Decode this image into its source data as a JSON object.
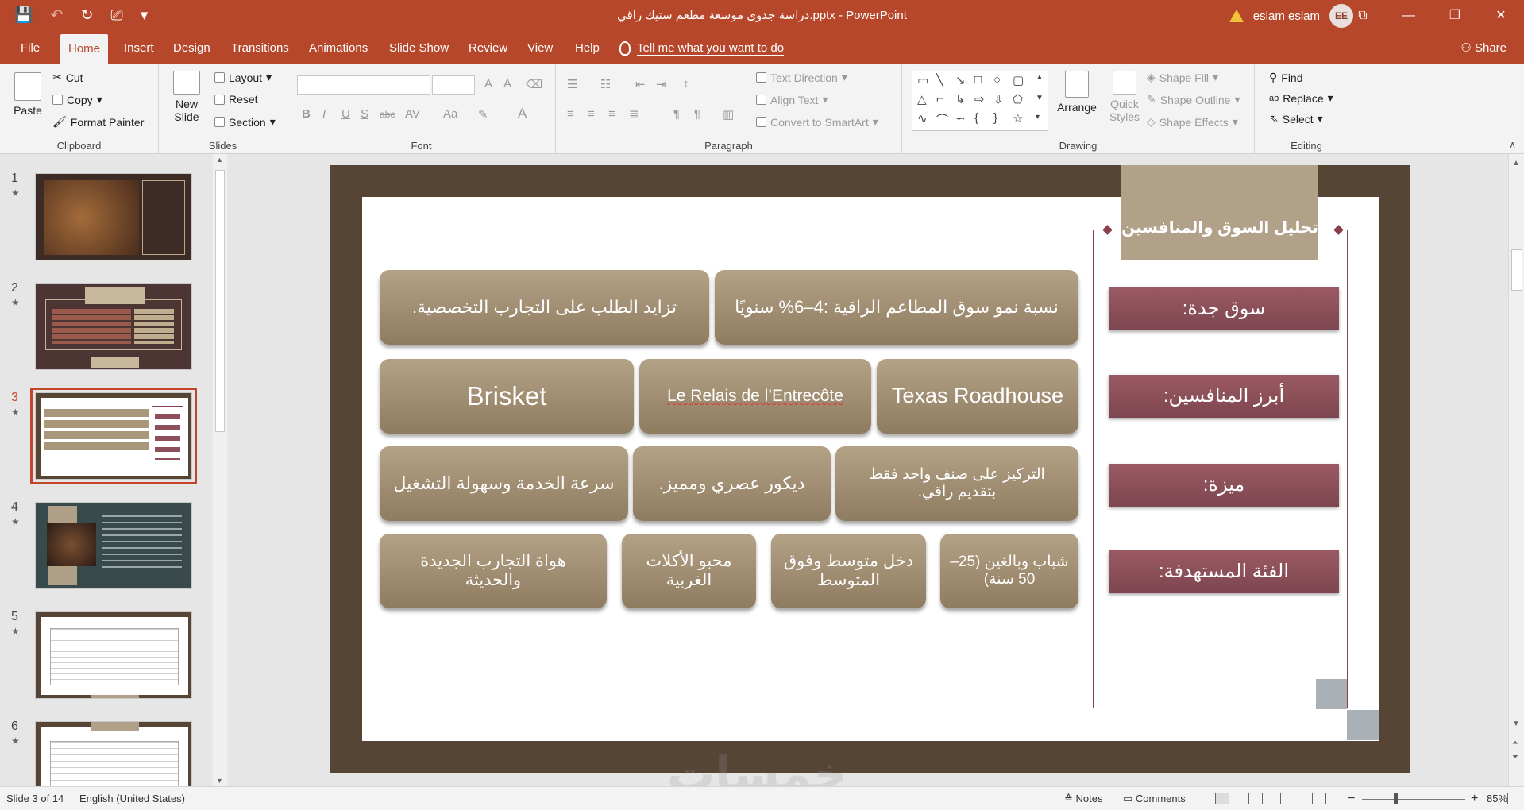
{
  "titlebar": {
    "doc_title": "دراسة جدوى موسعة مطعم ستيك راقي.pptx  -  PowerPoint",
    "user_name": "eslam eslam",
    "user_initials": "EE",
    "qat": {
      "save": "💾",
      "undo": "↶",
      "redo": "↻",
      "present": "⎚",
      "more": "▾"
    },
    "controls": {
      "ribbon_display": "⧉",
      "minimize": "—",
      "restore": "❐",
      "close": "✕"
    }
  },
  "tabs": [
    {
      "label": "File"
    },
    {
      "label": "Home"
    },
    {
      "label": "Insert"
    },
    {
      "label": "Design"
    },
    {
      "label": "Transitions"
    },
    {
      "label": "Animations"
    },
    {
      "label": "Slide Show"
    },
    {
      "label": "Review"
    },
    {
      "label": "View"
    },
    {
      "label": "Help"
    }
  ],
  "tell_me": "Tell me what you want to do",
  "share_label": "Share",
  "ribbon": {
    "clipboard": {
      "label": "Clipboard",
      "paste": "Paste",
      "cut": "Cut",
      "copy": "Copy",
      "format_painter": "Format Painter"
    },
    "slides": {
      "label": "Slides",
      "new_slide_1": "New",
      "new_slide_2": "Slide",
      "layout": "Layout",
      "reset": "Reset",
      "section": "Section"
    },
    "font": {
      "label": "Font"
    },
    "paragraph": {
      "label": "Paragraph",
      "text_direction": "Text Direction",
      "align_text": "Align Text",
      "convert_smartart": "Convert to SmartArt"
    },
    "drawing": {
      "label": "Drawing",
      "arrange": "Arrange",
      "quick_styles_1": "Quick",
      "quick_styles_2": "Styles",
      "shape_fill": "Shape Fill",
      "shape_outline": "Shape Outline",
      "shape_effects": "Shape Effects"
    },
    "editing": {
      "label": "Editing",
      "find": "Find",
      "replace": "Replace",
      "select": "Select"
    }
  },
  "thumbnails": [
    {
      "num": "1",
      "star": "★"
    },
    {
      "num": "2",
      "star": "★"
    },
    {
      "num": "3",
      "star": "★"
    },
    {
      "num": "4",
      "star": "★"
    },
    {
      "num": "5",
      "star": "★"
    },
    {
      "num": "6",
      "star": "★"
    }
  ],
  "slide": {
    "title": "تحليل السوق والمنافسين",
    "labels": [
      "سوق جدة:",
      "أبرز المنافسين:",
      "ميزة:",
      "الفئة المستهدفة:"
    ],
    "row1": [
      "نسبة نمو سوق المطاعم الراقية :4–6% سنويًا",
      "تزايد الطلب على التجارب التخصصية."
    ],
    "row2": [
      "Texas Roadhouse",
      "Le Relais de l’Entrecôte",
      "Brisket"
    ],
    "row3": [
      "التركيز على صنف واحد فقط بتقديم راقي.",
      "ديكور عصري ومميز.",
      "سرعة الخدمة وسهولة التشغيل"
    ],
    "row4": [
      "شباب وبالغين (25–50 سنة)",
      "دخل متوسط وفوق المتوسط",
      "محبو الأكلات الغربية",
      "هواة التجارب الجديدة والحديثة"
    ],
    "watermark": "خمسات"
  },
  "status": {
    "slide_of": "Slide 3 of 14",
    "language": "English (United States)",
    "notes": "Notes",
    "comments": "Comments",
    "zoom_minus": "−",
    "zoom_plus": "+",
    "zoom": "85%"
  },
  "colors": {
    "brand": "#b7472a",
    "slide_frame": "#564535",
    "card": "#9f8c6f",
    "label": "#8d4f59"
  }
}
